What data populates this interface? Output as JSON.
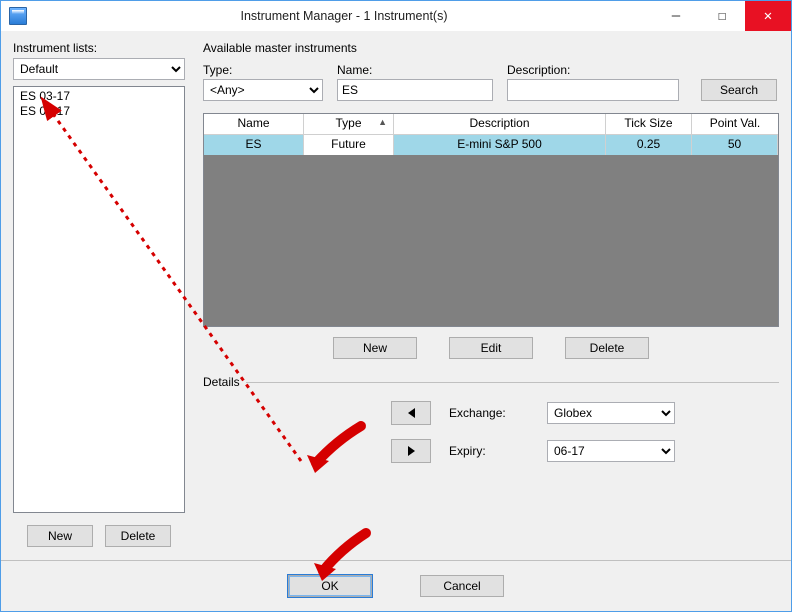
{
  "window": {
    "title": "Instrument Manager - 1 Instrument(s)"
  },
  "left": {
    "label": "Instrument lists:",
    "list_select": "Default",
    "items": [
      "ES 03-17",
      "ES 06-17"
    ],
    "new": "New",
    "delete": "Delete"
  },
  "right": {
    "title": "Available master instruments",
    "type_label": "Type:",
    "type_value": "<Any>",
    "name_label": "Name:",
    "name_value": "ES",
    "desc_label": "Description:",
    "desc_value": "",
    "search": "Search",
    "columns": {
      "name": "Name",
      "type": "Type",
      "desc": "Description",
      "tick": "Tick Size",
      "pv": "Point Val."
    },
    "row": {
      "name": "ES",
      "type": "Future",
      "desc": "E-mini S&P 500",
      "tick": "0.25",
      "pv": "50"
    },
    "btn_new": "New",
    "btn_edit": "Edit",
    "btn_delete": "Delete",
    "details": "Details",
    "exchange_label": "Exchange:",
    "exchange_value": "Globex",
    "expiry_label": "Expiry:",
    "expiry_value": "06-17"
  },
  "footer": {
    "ok": "OK",
    "cancel": "Cancel"
  }
}
